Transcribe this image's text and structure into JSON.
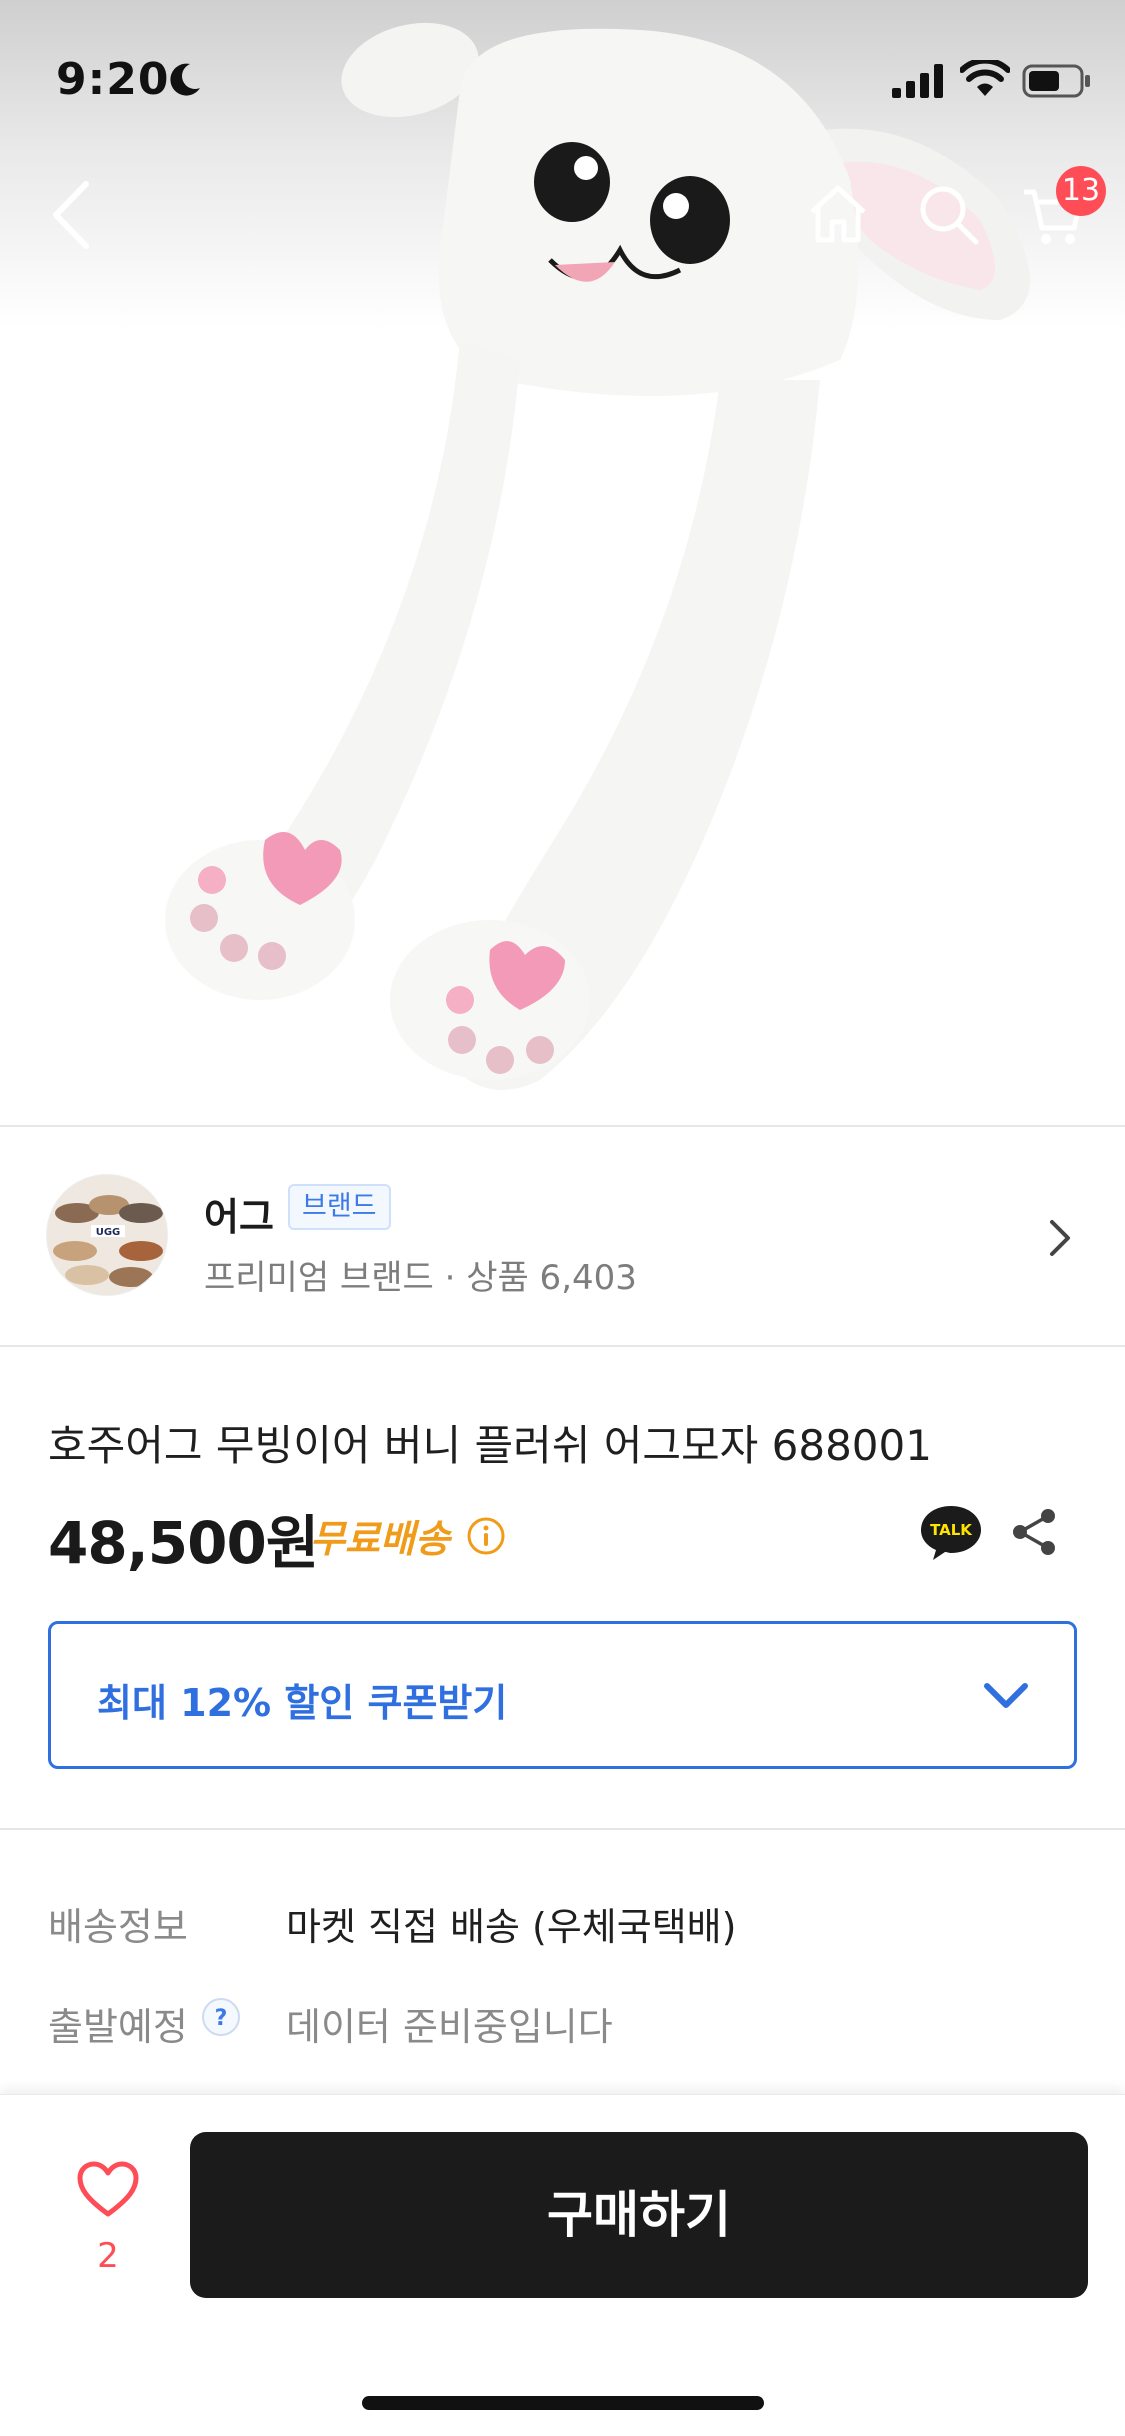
{
  "status_bar": {
    "time": "9:20"
  },
  "nav": {
    "cart_badge": "13"
  },
  "brand": {
    "name": "어그",
    "badge": "브랜드",
    "subtitle": "프리미엄 브랜드 · 상품 6,403",
    "logo_text": "UGG"
  },
  "product": {
    "title": "호주어그 무빙이어 버니 플러쉬 어그모자 688001",
    "price": "48,500원",
    "shipping_badge": "무료배송",
    "talk_label": "TALK"
  },
  "coupon": {
    "label": "최대 12% 할인 쿠폰받기"
  },
  "delivery": {
    "rows": [
      {
        "label": "배송정보",
        "value": "마켓 직접 배송 (우체국택배)"
      },
      {
        "label": "출발예정",
        "value": "데이터 준비중입니다"
      }
    ]
  },
  "bottom": {
    "like_count": "2",
    "buy_label": "구매하기"
  },
  "colors": {
    "accent_blue": "#2f6fe0",
    "shipping_orange": "#f19b1a",
    "badge_red": "#ff4d58",
    "button_dark": "#1b1b1b"
  }
}
